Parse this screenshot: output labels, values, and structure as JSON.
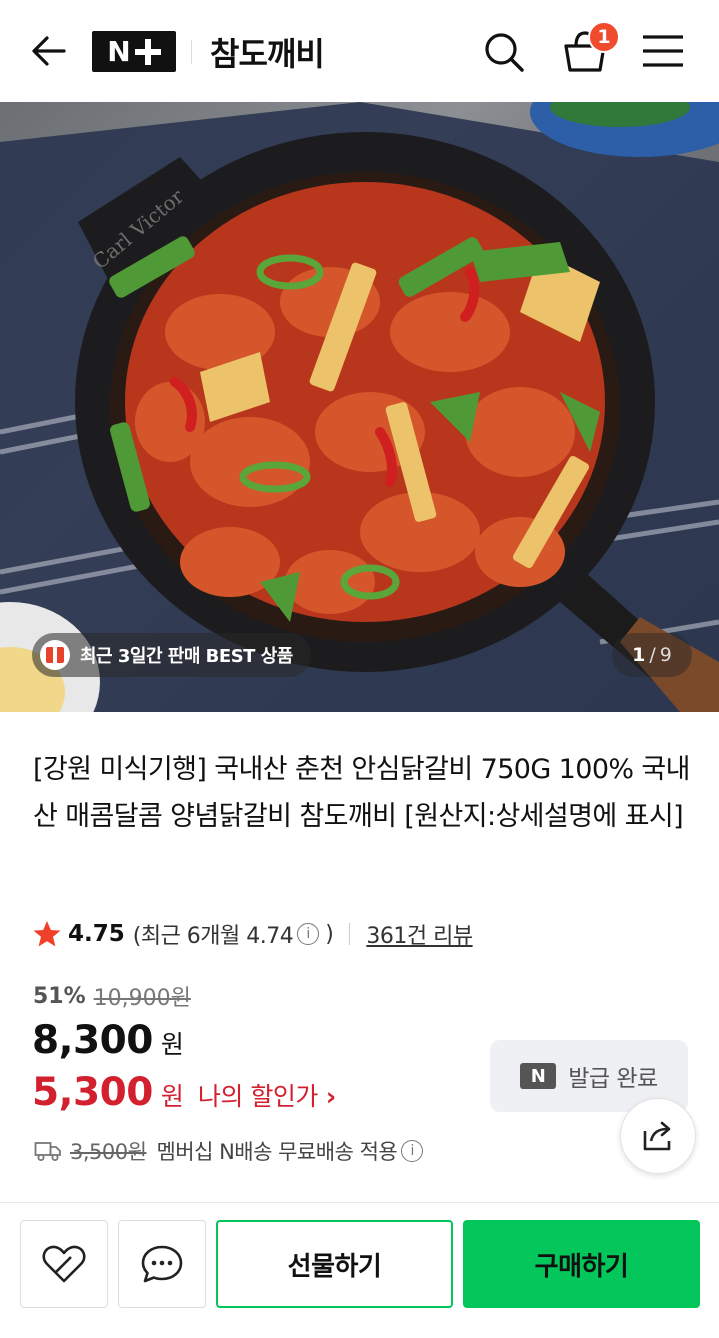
{
  "header": {
    "logo_text": "N",
    "store_name": "참도깨비",
    "cart_count": "1"
  },
  "hero": {
    "pan_brand": "Carl Victor",
    "badge_text": "최근 3일간 판매 BEST 상품",
    "page_current": "1",
    "page_sep": "/",
    "page_total": "9"
  },
  "product": {
    "title": "[강원 미식기행] 국내산 춘천 안심닭갈비 750G 100% 국내산 매콤달콤 양념닭갈비 참도깨비 [원산지:상세설명에 표시]",
    "rating": "4.75",
    "recent_rating_prefix": "(최근 6개월 4.74",
    "recent_rating_suffix": ")",
    "info_glyph": "i",
    "review_count": "361건 리뷰",
    "discount_pct": "51%",
    "original_price": "10,900원",
    "price": "8,300",
    "price_unit": "원",
    "my_price": "5,300",
    "my_price_unit": "원",
    "my_price_label": "나의 할인가",
    "my_price_chevron": "›",
    "coupon_icon_text": "N",
    "coupon_text": "발급 완료",
    "shipping_original": "3,500원",
    "shipping_text": "멤버십 N배송 무료배송 적용"
  },
  "bottom_bar": {
    "gift_label": "선물하기",
    "buy_label": "구매하기"
  },
  "colors": {
    "accent_green": "#03c75a",
    "discount_red": "#d3202f",
    "badge_orange": "#f04b2d"
  }
}
